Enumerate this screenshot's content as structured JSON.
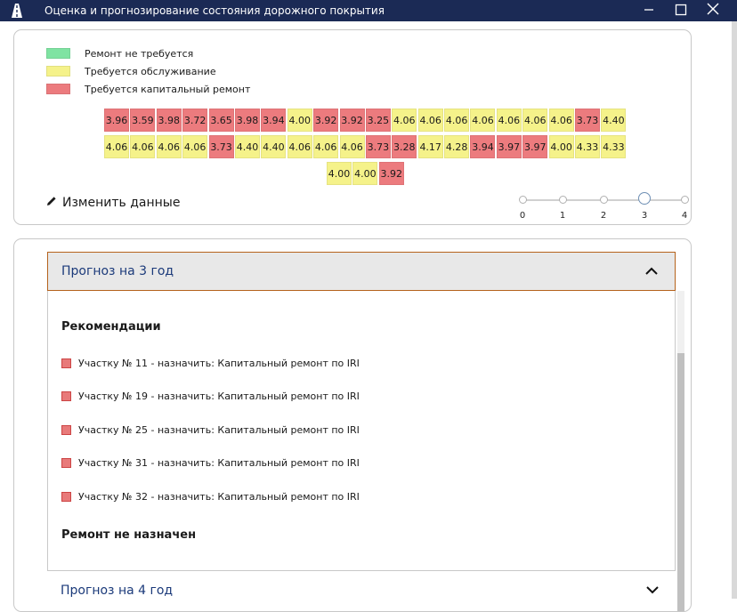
{
  "window": {
    "title": "Оценка и прогнозирование состояния дорожного покрытия",
    "minimize_icon": "minimize-icon",
    "maximize_icon": "maximize-icon",
    "close_icon": "close-icon"
  },
  "colors": {
    "green": "#7fe3a2",
    "yellow": "#f5f28a",
    "red": "#ec7b7e",
    "titlebar": "#1b2a55",
    "accent_border": "#b5621c",
    "link": "#1b3a7a"
  },
  "legend": [
    {
      "label": "Ремонт не требуется",
      "color": "green"
    },
    {
      "label": "Требуется обслуживание",
      "color": "yellow"
    },
    {
      "label": "Требуется капитальный ремонт",
      "color": "red"
    }
  ],
  "grid": {
    "rows": [
      [
        {
          "v": "3.96",
          "c": "red"
        },
        {
          "v": "3.59",
          "c": "red"
        },
        {
          "v": "3.98",
          "c": "red"
        },
        {
          "v": "3.72",
          "c": "red"
        },
        {
          "v": "3.65",
          "c": "red"
        },
        {
          "v": "3.98",
          "c": "red"
        },
        {
          "v": "3.94",
          "c": "red"
        },
        {
          "v": "4.00",
          "c": "yellow"
        },
        {
          "v": "3.92",
          "c": "red"
        },
        {
          "v": "3.92",
          "c": "red"
        },
        {
          "v": "3.25",
          "c": "red"
        },
        {
          "v": "4.06",
          "c": "yellow"
        },
        {
          "v": "4.06",
          "c": "yellow"
        },
        {
          "v": "4.06",
          "c": "yellow"
        },
        {
          "v": "4.06",
          "c": "yellow"
        },
        {
          "v": "4.06",
          "c": "yellow"
        },
        {
          "v": "4.06",
          "c": "yellow"
        },
        {
          "v": "4.06",
          "c": "yellow"
        },
        {
          "v": "3.73",
          "c": "red"
        },
        {
          "v": "4.40",
          "c": "yellow"
        }
      ],
      [
        {
          "v": "4.06",
          "c": "yellow"
        },
        {
          "v": "4.06",
          "c": "yellow"
        },
        {
          "v": "4.06",
          "c": "yellow"
        },
        {
          "v": "4.06",
          "c": "yellow"
        },
        {
          "v": "3.73",
          "c": "red"
        },
        {
          "v": "4.40",
          "c": "yellow"
        },
        {
          "v": "4.40",
          "c": "yellow"
        },
        {
          "v": "4.06",
          "c": "yellow"
        },
        {
          "v": "4.06",
          "c": "yellow"
        },
        {
          "v": "4.06",
          "c": "yellow"
        },
        {
          "v": "3.73",
          "c": "red"
        },
        {
          "v": "3.28",
          "c": "red"
        },
        {
          "v": "4.17",
          "c": "yellow"
        },
        {
          "v": "4.28",
          "c": "yellow"
        },
        {
          "v": "3.94",
          "c": "red"
        },
        {
          "v": "3.97",
          "c": "red"
        },
        {
          "v": "3.97",
          "c": "red"
        },
        {
          "v": "4.00",
          "c": "yellow"
        },
        {
          "v": "4.33",
          "c": "yellow"
        },
        {
          "v": "4.33",
          "c": "yellow"
        }
      ],
      [
        {
          "v": "4.00",
          "c": "yellow"
        },
        {
          "v": "4.00",
          "c": "yellow"
        },
        {
          "v": "3.92",
          "c": "red"
        }
      ]
    ]
  },
  "edit": {
    "label": "Изменить данные",
    "icon": "pencil-icon"
  },
  "slider": {
    "ticks": [
      "0",
      "1",
      "2",
      "3",
      "4"
    ],
    "value": 3
  },
  "forecast_open": {
    "header": "Прогноз на 3 год",
    "recommendations_title": "Рекомендации",
    "items": [
      "Участку № 11 - назначить: Капитальный ремонт по IRI",
      "Участку № 19 - назначить: Капитальный ремонт по IRI",
      "Участку № 25 - назначить: Капитальный ремонт по IRI",
      "Участку № 31 - назначить: Капитальный ремонт по IRI",
      "Участку № 32 - назначить: Капитальный ремонт по IRI"
    ],
    "no_repair_title": "Ремонт не назначен"
  },
  "forecast_next": {
    "header": "Прогноз на 4 год"
  }
}
